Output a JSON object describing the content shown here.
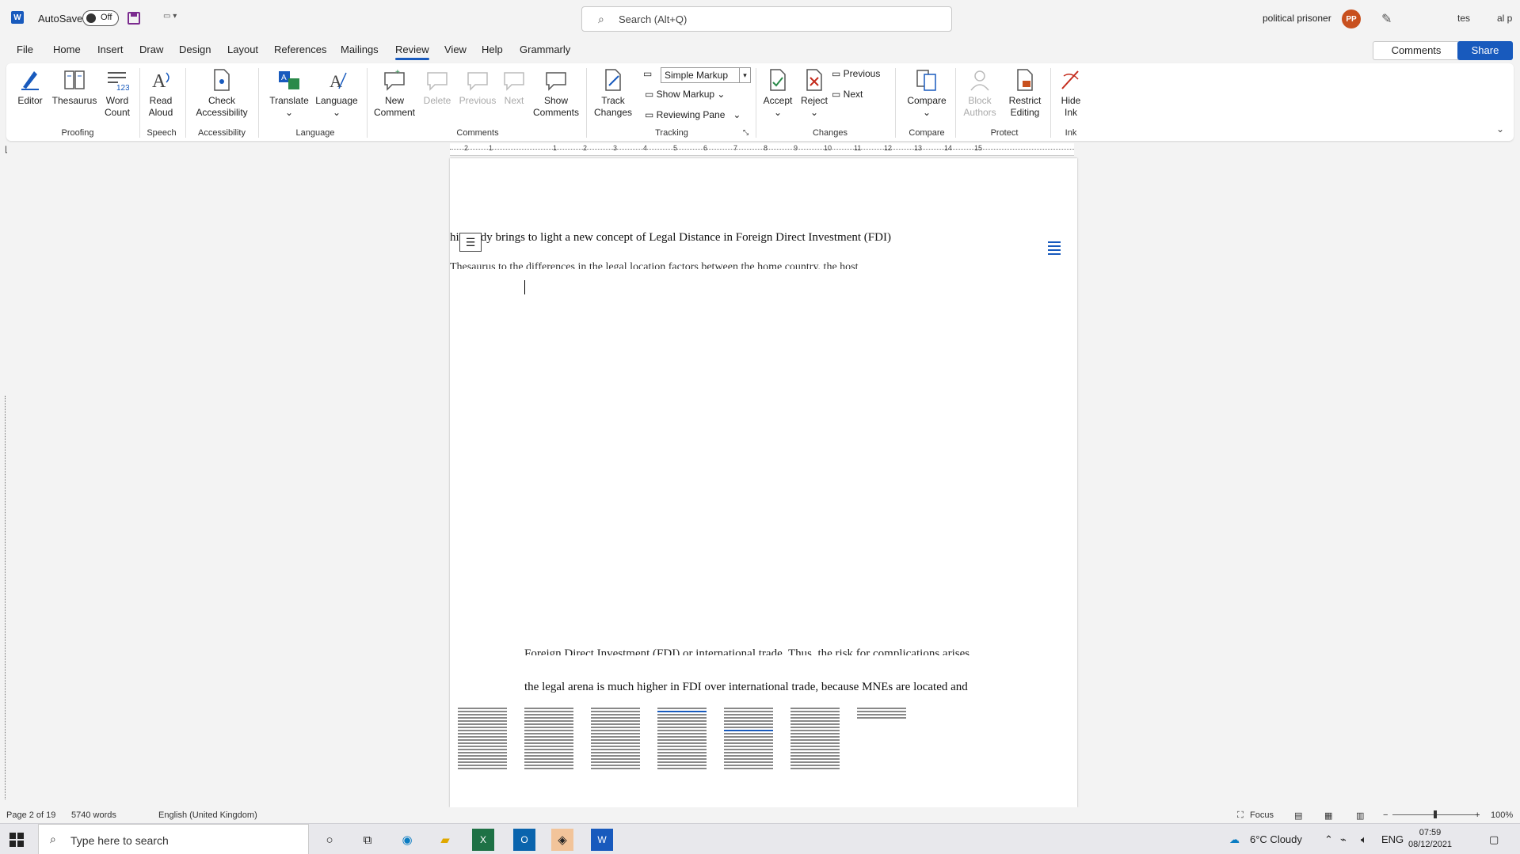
{
  "titlebar": {
    "app_logo": "W",
    "autosave_label": "AutoSave",
    "autosave_state": "Off",
    "search_placeholder": "Search (Alt+Q)",
    "user_name": "political prisoner",
    "avatar_initials": "PP",
    "extra_1": "tes",
    "extra_2": "al p"
  },
  "menu_tabs": [
    "File",
    "Home",
    "Insert",
    "Draw",
    "Design",
    "Layout",
    "References",
    "Mailings",
    "Review",
    "View",
    "Help",
    "Grammarly"
  ],
  "active_tab": "Review",
  "header_buttons": {
    "comments": "Comments",
    "share": "Share"
  },
  "ribbon": {
    "proofing": {
      "label": "Proofing",
      "editor": "Editor",
      "thesaurus": "Thesaurus",
      "word_count_1": "Word",
      "word_count_2": "Count"
    },
    "speech": {
      "label": "Speech",
      "read_aloud_1": "Read",
      "read_aloud_2": "Aloud"
    },
    "accessibility": {
      "label": "Accessibility",
      "check_1": "Check",
      "check_2": "Accessibility"
    },
    "language": {
      "label": "Language",
      "translate": "Translate",
      "language": "Language"
    },
    "comments": {
      "label": "Comments",
      "new_1": "New",
      "new_2": "Comment",
      "delete": "Delete",
      "previous": "Previous",
      "next": "Next",
      "show_1": "Show",
      "show_2": "Comments"
    },
    "tracking": {
      "label": "Tracking",
      "track_1": "Track",
      "track_2": "Changes",
      "markup_select": "Simple Markup",
      "show_markup": "Show Markup",
      "reviewing_pane": "Reviewing Pane"
    },
    "changes": {
      "label": "Changes",
      "accept": "Accept",
      "reject": "Reject",
      "previous": "Previous",
      "next": "Next"
    },
    "compare": {
      "label": "Compare",
      "compare": "Compare"
    },
    "protect": {
      "label": "Protect",
      "block_1": "Block",
      "block_2": "Authors",
      "restrict_1": "Restrict",
      "restrict_2": "Editing"
    },
    "ink": {
      "label": "Ink",
      "hide_1": "Hide",
      "hide_2": "Ink"
    }
  },
  "ruler_numbers": [
    "2",
    "1",
    "1",
    "2",
    "3",
    "4",
    "5",
    "6",
    "7",
    "8",
    "9",
    "10",
    "11",
    "12",
    "13",
    "14",
    "15"
  ],
  "document": {
    "line_1": "his study brings to light a new concept of Legal Distance in Foreign Direct Investment (FDI)",
    "line_2": "Thesaurus to the differences in the legal location factors between the home country, the host",
    "line_3": "Foreign Direct Investment (FDI) or international trade. Thus, the risk for complications arises",
    "line_4": "the legal arena is much higher in FDI over international trade, because MNEs are located and"
  },
  "status": {
    "page": "Page 2 of 19",
    "words": "5740 words",
    "language": "English (United Kingdom)",
    "focus": "Focus",
    "zoom": "100%"
  },
  "taskbar": {
    "search_placeholder": "Type here to search",
    "weather": "6°C  Cloudy",
    "lang": "ENG",
    "time": "07:59",
    "date": "08/12/2021"
  },
  "colors": {
    "word_blue": "#185abd",
    "avatar": "#c8501e"
  }
}
